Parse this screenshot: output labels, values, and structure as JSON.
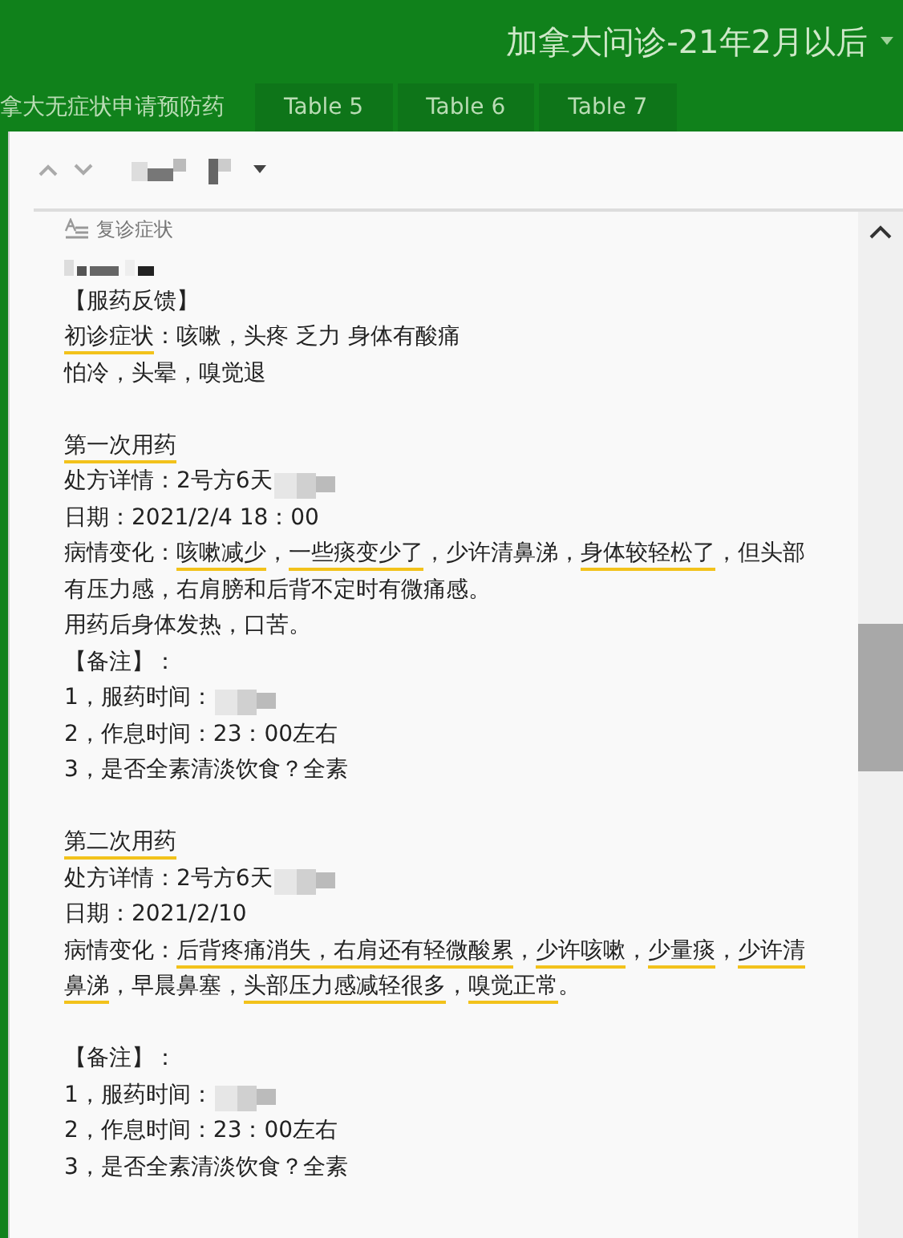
{
  "header": {
    "title": "加拿大问诊-21年2月以后"
  },
  "tabs": [
    {
      "label": "拿大无症状申请预防药",
      "selected": true
    },
    {
      "label": "Table 5",
      "selected": false
    },
    {
      "label": "Table 6",
      "selected": false
    },
    {
      "label": "Table 7",
      "selected": false
    }
  ],
  "field": {
    "label": "复诊症状"
  },
  "lines": [
    {
      "kind": "redacted"
    },
    {
      "kind": "text",
      "segments": [
        {
          "text": "【服药反馈】",
          "underlined": false
        }
      ]
    },
    {
      "kind": "text",
      "segments": [
        {
          "text": "初诊症状",
          "underlined": true
        },
        {
          "text": "：咳嗽，头疼  乏力  身体有酸痛",
          "underlined": false
        }
      ]
    },
    {
      "kind": "text",
      "segments": [
        {
          "text": "怕冷，头晕，嗅觉退",
          "underlined": false
        }
      ]
    },
    {
      "kind": "gap"
    },
    {
      "kind": "text",
      "segments": [
        {
          "text": "第一次用药",
          "underlined": true
        }
      ]
    },
    {
      "kind": "text",
      "redacted": true,
      "segments": [
        {
          "text": "处方详情：2号方6天",
          "underlined": false
        }
      ]
    },
    {
      "kind": "text",
      "segments": [
        {
          "text": "日期：2021/2/4  18：00",
          "underlined": false
        }
      ]
    },
    {
      "kind": "text",
      "segments": [
        {
          "text": "病情变化：",
          "underlined": false
        },
        {
          "text": "咳嗽减少",
          "underlined": true
        },
        {
          "text": "，",
          "underlined": false
        },
        {
          "text": "一些痰变少了",
          "underlined": true
        },
        {
          "text": "，少许清鼻涕，",
          "underlined": false
        },
        {
          "text": "身体较轻松了",
          "underlined": true
        },
        {
          "text": "，但头部有压力感，右肩膀和后背不定时有微痛感。",
          "underlined": false
        }
      ]
    },
    {
      "kind": "text",
      "segments": [
        {
          "text": "用药后身体发热，口苦。",
          "underlined": false
        }
      ]
    },
    {
      "kind": "text",
      "segments": [
        {
          "text": "【备注】：",
          "underlined": false
        }
      ]
    },
    {
      "kind": "text",
      "redacted": true,
      "segments": [
        {
          "text": "1，服药时间：",
          "underlined": false
        }
      ]
    },
    {
      "kind": "text",
      "segments": [
        {
          "text": "2，作息时间：23：00左右",
          "underlined": false
        }
      ]
    },
    {
      "kind": "text",
      "segments": [
        {
          "text": "3，是否全素清淡饮食？全素",
          "underlined": false
        }
      ]
    },
    {
      "kind": "gap"
    },
    {
      "kind": "text",
      "segments": [
        {
          "text": "第二次用药",
          "underlined": true
        }
      ]
    },
    {
      "kind": "text",
      "redacted": true,
      "segments": [
        {
          "text": "处方详情：2号方6天",
          "underlined": false
        }
      ]
    },
    {
      "kind": "text",
      "segments": [
        {
          "text": "日期：2021/2/10",
          "underlined": false
        }
      ]
    },
    {
      "kind": "text",
      "segments": [
        {
          "text": "病情变化：",
          "underlined": false
        },
        {
          "text": "后背疼痛消失，右肩还有轻微酸累",
          "underlined": true
        },
        {
          "text": "，",
          "underlined": false
        },
        {
          "text": "少许咳嗽",
          "underlined": true
        },
        {
          "text": "，",
          "underlined": false
        },
        {
          "text": "少量痰",
          "underlined": true
        },
        {
          "text": "，",
          "underlined": false
        },
        {
          "text": "少许清鼻涕",
          "underlined": true
        },
        {
          "text": "，早晨鼻塞，",
          "underlined": false
        },
        {
          "text": "头部压力感减轻很多",
          "underlined": true
        },
        {
          "text": "，",
          "underlined": false
        },
        {
          "text": "嗅觉正常",
          "underlined": true
        },
        {
          "text": "。",
          "underlined": false
        }
      ]
    },
    {
      "kind": "gap"
    },
    {
      "kind": "text",
      "segments": [
        {
          "text": "【备注】：",
          "underlined": false
        }
      ]
    },
    {
      "kind": "text",
      "redacted": true,
      "segments": [
        {
          "text": "1，服药时间：",
          "underlined": false
        }
      ]
    },
    {
      "kind": "text",
      "segments": [
        {
          "text": "2，作息时间：23：00左右",
          "underlined": false
        }
      ]
    },
    {
      "kind": "text",
      "segments": [
        {
          "text": "3，是否全素清淡饮食？全素",
          "underlined": false
        }
      ]
    }
  ]
}
